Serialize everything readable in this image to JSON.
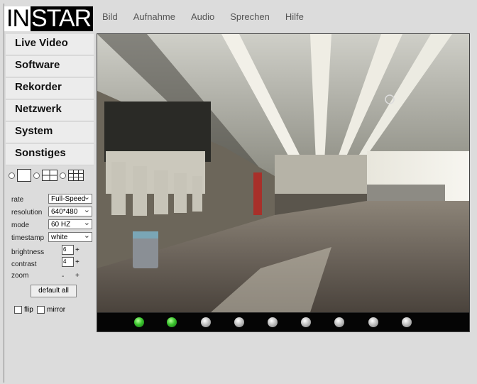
{
  "logo": {
    "part1": "IN",
    "part2": "STAR"
  },
  "menu": [
    "Bild",
    "Aufnahme",
    "Audio",
    "Sprechen",
    "Hilfe"
  ],
  "nav": [
    "Live Video",
    "Software",
    "Rekorder",
    "Netzwerk",
    "System",
    "Sonstiges"
  ],
  "controls": {
    "rate": {
      "label": "rate",
      "value": "Full-Speed"
    },
    "resolution": {
      "label": "resolution",
      "value": "640*480"
    },
    "mode": {
      "label": "mode",
      "value": "60 HZ"
    },
    "timestamp": {
      "label": "timestamp",
      "value": "white"
    },
    "brightness": {
      "label": "brightness",
      "value": "6",
      "plus": "+"
    },
    "contrast": {
      "label": "contrast",
      "value": "4",
      "plus": "+"
    },
    "zoom": {
      "label": "zoom",
      "minus": "-",
      "plus": "+"
    }
  },
  "buttons": {
    "default_all": "default all"
  },
  "checkboxes": {
    "flip": "flip",
    "mirror": "mirror"
  },
  "ptz_indicators": {
    "active": [
      true,
      true,
      false,
      false,
      false,
      false,
      false,
      false,
      false
    ]
  }
}
